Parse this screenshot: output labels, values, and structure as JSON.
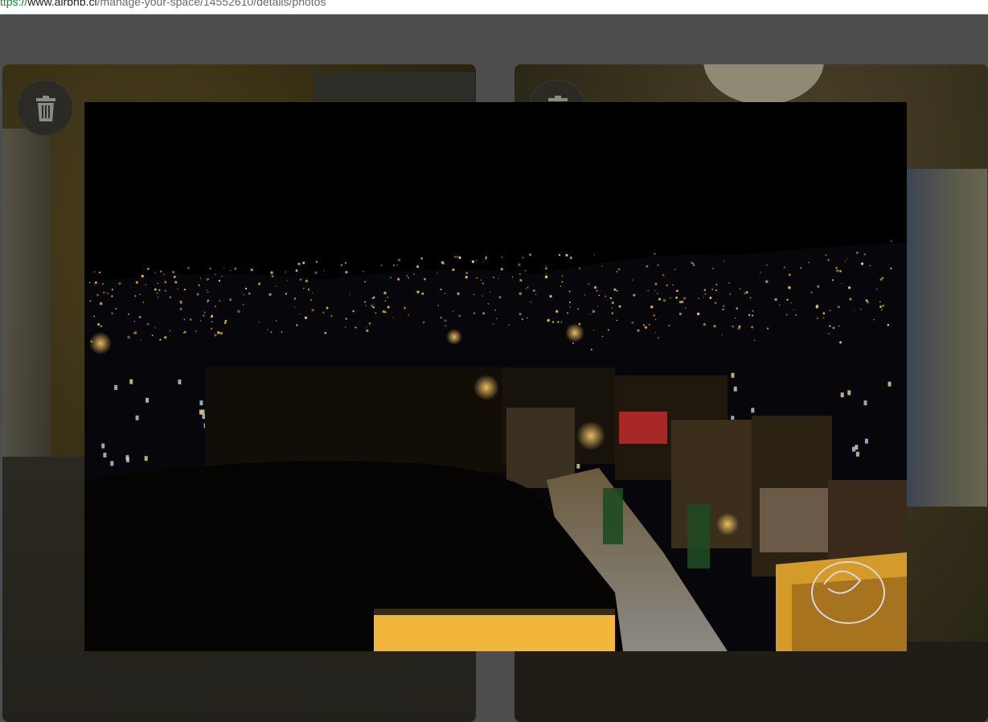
{
  "browser": {
    "url_scheme": "ttps://",
    "url_host": "www.airbnb.cl",
    "url_path": "/manage-your-space/14552610/details/photos"
  },
  "photos": [
    {
      "icon": "trash-icon"
    },
    {
      "icon": "trash-icon"
    }
  ],
  "lightbox": {
    "photo_subject": "night city view",
    "watermark_color": "#d8d8e0"
  },
  "colors": {
    "backdrop": "#4d4d4d",
    "overlay": "#000000",
    "city_lights": "#f2c14e"
  }
}
